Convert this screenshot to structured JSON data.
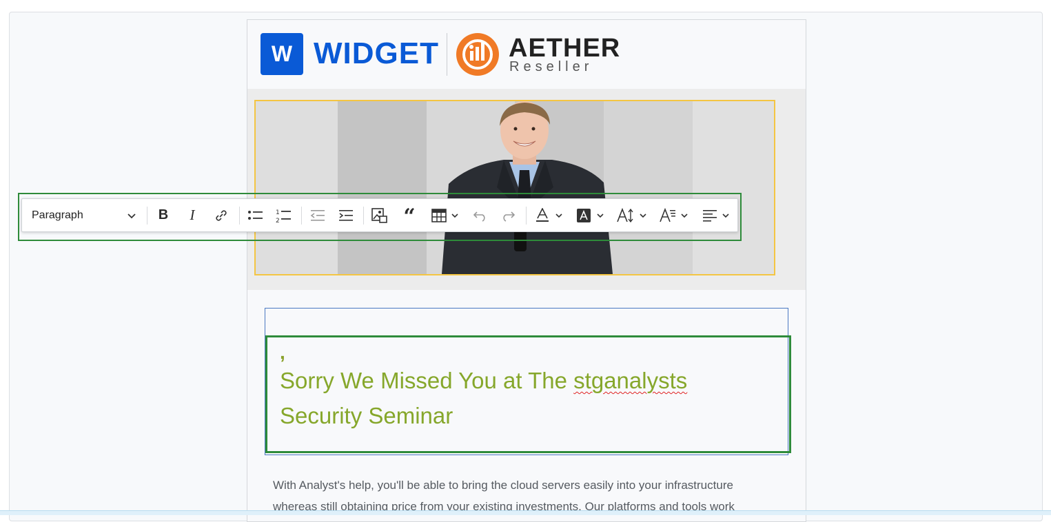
{
  "header": {
    "widget_mark": "W",
    "widget_name": "WIDGET",
    "partner_name": "AETHER",
    "partner_tagline": "Reseller"
  },
  "colors": {
    "widget_blue": "#0a5ad6",
    "aether_orange": "#f07a26",
    "heading_green": "#86a72b",
    "selection_green": "#2e8b3a",
    "image_selection_yellow": "#f4c542"
  },
  "toolbar": {
    "paragraph_style": "Paragraph",
    "buttons": [
      {
        "name": "bold",
        "icon": "bold-icon"
      },
      {
        "name": "italic",
        "icon": "italic-icon"
      },
      {
        "name": "link",
        "icon": "link-icon"
      },
      {
        "name": "bulleted-list",
        "icon": "bulleted-list-icon"
      },
      {
        "name": "numbered-list",
        "icon": "numbered-list-icon"
      },
      {
        "name": "outdent",
        "icon": "outdent-icon"
      },
      {
        "name": "indent",
        "icon": "indent-icon"
      },
      {
        "name": "insert-image",
        "icon": "image-icon"
      },
      {
        "name": "block-quote",
        "icon": "quote-icon"
      },
      {
        "name": "insert-table",
        "icon": "table-icon"
      },
      {
        "name": "undo",
        "icon": "undo-icon"
      },
      {
        "name": "redo",
        "icon": "redo-icon"
      },
      {
        "name": "font-color",
        "icon": "font-color-icon"
      },
      {
        "name": "font-background-color",
        "icon": "font-background-icon"
      },
      {
        "name": "font-size",
        "icon": "font-size-icon"
      },
      {
        "name": "font-family",
        "icon": "font-family-icon"
      },
      {
        "name": "alignment",
        "icon": "align-left-icon"
      }
    ]
  },
  "content": {
    "comma": ",",
    "heading_part1": "Sorry We Missed You at The ",
    "heading_misspelled": "stganalysts",
    "heading_line2": "Security Seminar",
    "body_line1": "With Analyst's help, you'll be able to bring the cloud servers easily into your infrastructure",
    "body_line2": "whereas still obtaining price from your existing investments. Our platforms and tools work"
  }
}
